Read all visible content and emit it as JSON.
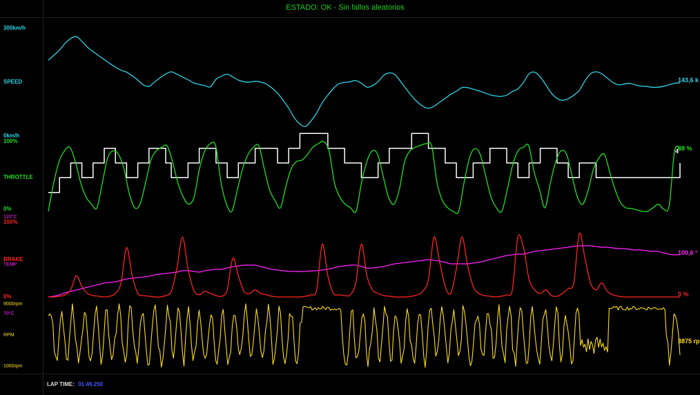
{
  "status": {
    "label": "ESTADO: OK - Sin fallos aleatorios",
    "color": "#1fd11f"
  },
  "speed": {
    "color": "#2fd4e6",
    "max_label": "300km/h",
    "name_label": "SPEED",
    "min_label": "0km/h",
    "current_value": "143,6 k",
    "range": [
      0,
      300
    ],
    "samples": [
      200,
      213,
      226,
      243,
      255,
      260,
      248,
      233,
      222,
      212,
      202,
      192,
      183,
      175,
      170,
      161,
      150,
      138,
      134,
      145,
      156,
      165,
      171,
      165,
      158,
      151,
      143,
      139,
      136,
      133,
      152,
      160,
      165,
      158,
      150,
      146,
      145,
      147,
      145,
      140,
      130,
      117,
      99,
      79,
      55,
      39,
      33,
      47,
      67,
      93,
      112,
      129,
      141,
      144,
      146,
      149,
      142,
      132,
      136,
      146,
      162,
      168,
      164,
      147,
      128,
      110,
      95,
      84,
      79,
      84,
      94,
      104,
      114,
      122,
      131,
      131,
      127,
      123,
      118,
      113,
      110,
      109,
      112,
      121,
      128,
      144,
      166,
      170,
      158,
      138,
      117,
      104,
      99,
      103,
      112,
      124,
      148,
      166,
      171,
      166,
      155,
      144,
      138,
      140,
      142,
      138,
      135,
      134,
      132,
      132,
      134,
      138,
      142,
      143
    ]
  },
  "throttle": {
    "color": "#22e022",
    "max_label": "100%",
    "name_label": "THROTTLE",
    "min_label": "0%",
    "current_value": "88 %",
    "range": [
      0,
      100
    ],
    "samples": [
      0,
      40,
      70,
      85,
      90,
      70,
      40,
      20,
      10,
      5,
      40,
      75,
      85,
      80,
      60,
      25,
      5,
      10,
      40,
      72,
      85,
      90,
      92,
      70,
      40,
      20,
      10,
      20,
      60,
      85,
      95,
      92,
      40,
      10,
      0,
      30,
      60,
      80,
      90,
      92,
      60,
      30,
      15,
      5,
      35,
      60,
      70,
      72,
      80,
      90,
      95,
      98,
      85,
      40,
      20,
      10,
      5,
      0,
      40,
      70,
      85,
      80,
      50,
      20,
      10,
      30,
      70,
      85,
      90,
      93,
      95,
      92,
      40,
      15,
      5,
      0,
      0,
      40,
      75,
      88,
      80,
      50,
      20,
      5,
      0,
      30,
      65,
      85,
      90,
      92,
      55,
      30,
      5,
      40,
      70,
      85,
      80,
      50,
      20,
      10,
      30,
      60,
      75,
      80,
      55,
      30,
      12,
      5,
      4,
      2,
      0,
      0,
      5,
      10,
      3,
      8,
      85,
      88
    ]
  },
  "gear": {
    "color": "#ffffff",
    "current_value": "4",
    "samples": [
      2,
      2,
      3,
      3,
      4,
      4,
      3,
      3,
      4,
      4,
      5,
      5,
      4,
      4,
      3,
      3,
      4,
      4,
      5,
      5,
      5,
      4,
      3,
      3,
      3,
      4,
      4,
      5,
      5,
      5,
      4,
      4,
      3,
      3,
      4,
      4,
      4,
      5,
      5,
      5,
      5,
      4,
      4,
      5,
      5,
      6,
      6,
      6,
      6,
      6,
      5,
      5,
      5,
      4,
      4,
      4,
      3,
      3,
      3,
      4,
      4,
      5,
      5,
      5,
      5,
      6,
      6,
      6,
      5,
      5,
      5,
      4,
      4,
      3,
      3,
      3,
      4,
      4,
      4,
      5,
      5,
      5,
      4,
      4,
      3,
      3,
      4,
      4,
      5,
      5,
      5,
      4,
      4,
      3,
      3,
      4,
      4,
      4,
      3,
      3,
      3,
      3,
      3,
      3,
      3,
      3,
      3,
      3,
      3,
      3,
      3,
      3,
      3,
      4
    ]
  },
  "brake": {
    "color": "#ff2424",
    "max_label": "100%",
    "name_label": "BRAKE",
    "min_label": "0%",
    "current_value": "0 %",
    "range": [
      0,
      100
    ],
    "samples": [
      0,
      0,
      1,
      3,
      10,
      30,
      15,
      5,
      2,
      1,
      0,
      1,
      5,
      20,
      70,
      30,
      5,
      2,
      1,
      0,
      0,
      2,
      8,
      40,
      85,
      40,
      10,
      3,
      8,
      5,
      2,
      1,
      10,
      55,
      30,
      8,
      5,
      10,
      5,
      3,
      1,
      0,
      0,
      0,
      0,
      0,
      1,
      3,
      10,
      75,
      30,
      5,
      3,
      2,
      3,
      20,
      75,
      30,
      10,
      5,
      2,
      1,
      0,
      0,
      0,
      1,
      3,
      8,
      25,
      85,
      50,
      15,
      5,
      40,
      85,
      45,
      15,
      5,
      2,
      1,
      0,
      1,
      3,
      10,
      85,
      70,
      25,
      10,
      5,
      10,
      2,
      1,
      5,
      12,
      20,
      90,
      55,
      20,
      10,
      20,
      8,
      3,
      1,
      0,
      0,
      0,
      0,
      0,
      0,
      0,
      0,
      0,
      0,
      0
    ]
  },
  "temp": {
    "color": "#ff24ff",
    "max_label": "120°C",
    "name_label": "TEMP",
    "min_label": "70°C",
    "current_value": "100,6 °",
    "range": [
      70,
      120
    ],
    "samples": [
      70,
      70.5,
      71.5,
      73,
      74,
      75,
      76,
      77,
      78,
      79,
      80,
      80.5,
      81,
      82,
      83,
      83.5,
      84,
      84.5,
      85,
      86,
      86.5,
      87,
      87.5,
      88,
      89,
      89,
      88.5,
      88,
      89,
      89.5,
      90,
      90,
      91,
      92,
      92.5,
      93,
      93,
      93,
      92,
      91,
      90,
      89.5,
      89,
      88.5,
      88.5,
      88.3,
      88.5,
      88.8,
      89,
      89.5,
      90,
      91,
      92,
      92.5,
      93,
      93,
      92,
      91,
      91,
      91.5,
      92,
      93,
      94,
      94.5,
      95,
      95.5,
      96,
      96.5,
      97,
      96.5,
      96,
      95,
      94,
      94,
      94,
      94,
      94.5,
      95,
      96,
      97,
      98,
      99,
      100,
      100.5,
      101,
      101,
      102,
      103,
      103.5,
      104,
      104.5,
      105,
      105.5,
      106,
      106.5,
      107,
      107,
      107,
      106.5,
      106,
      106,
      105.5,
      105,
      105,
      104.5,
      104,
      104,
      103.5,
      103,
      103,
      102,
      101,
      100.5,
      100.6
    ]
  },
  "rpm": {
    "color": "#ffdd22",
    "max_label": "9000rpm",
    "name_label": "RPM",
    "min_label": "1000rpm",
    "current_value": "3875 rp",
    "range": [
      1000,
      9000
    ]
  },
  "lap": {
    "label": "LAP TIME:",
    "value": "01:46.250",
    "value_color": "#4455ff"
  }
}
